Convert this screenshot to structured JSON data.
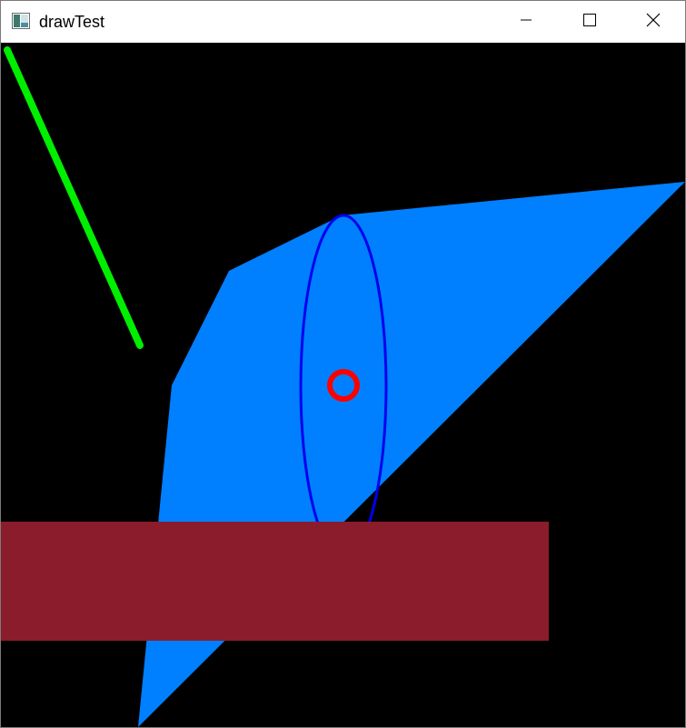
{
  "window": {
    "title": "drawTest",
    "icon": "app-window-icon"
  },
  "caption_buttons": {
    "minimize": "minimize-icon",
    "maximize": "maximize-icon",
    "close": "close-icon"
  },
  "colors": {
    "background": "#000000",
    "line": "#00ee00",
    "polygon": "#0080ff",
    "ellipse": "#0000ee",
    "circle": "#ff0000",
    "rectangle": "#8b1c2b"
  }
}
